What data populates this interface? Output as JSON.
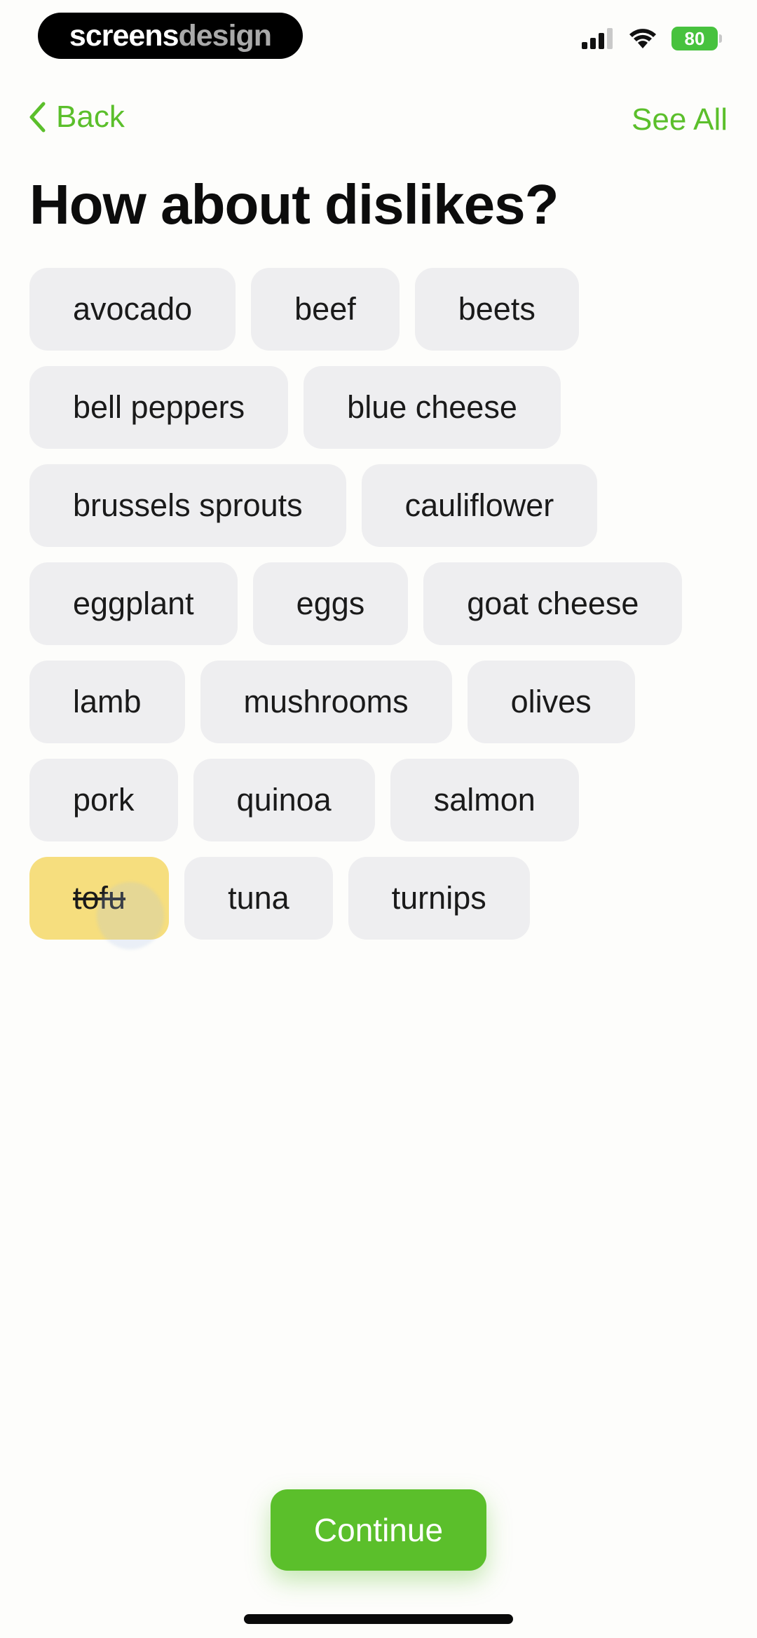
{
  "status_bar": {
    "brand_part1": "screens",
    "brand_part2": "design",
    "battery": "80"
  },
  "nav": {
    "back_label": "Back",
    "see_all_label": "See All"
  },
  "title": "How about dislikes?",
  "chips": [
    {
      "label": "avocado",
      "selected": false
    },
    {
      "label": "beef",
      "selected": false
    },
    {
      "label": "beets",
      "selected": false
    },
    {
      "label": "bell peppers",
      "selected": false
    },
    {
      "label": "blue cheese",
      "selected": false
    },
    {
      "label": "brussels sprouts",
      "selected": false
    },
    {
      "label": "cauliflower",
      "selected": false
    },
    {
      "label": "eggplant",
      "selected": false
    },
    {
      "label": "eggs",
      "selected": false
    },
    {
      "label": "goat cheese",
      "selected": false
    },
    {
      "label": "lamb",
      "selected": false
    },
    {
      "label": "mushrooms",
      "selected": false
    },
    {
      "label": "olives",
      "selected": false
    },
    {
      "label": "pork",
      "selected": false
    },
    {
      "label": "quinoa",
      "selected": false
    },
    {
      "label": "salmon",
      "selected": false
    },
    {
      "label": "tofu",
      "selected": true
    },
    {
      "label": "tuna",
      "selected": false
    },
    {
      "label": "turnips",
      "selected": false
    }
  ],
  "continue_label": "Continue",
  "colors": {
    "accent": "#5bbf2b",
    "chip_bg": "#eeeef0",
    "chip_selected_bg": "#f6de7e"
  }
}
